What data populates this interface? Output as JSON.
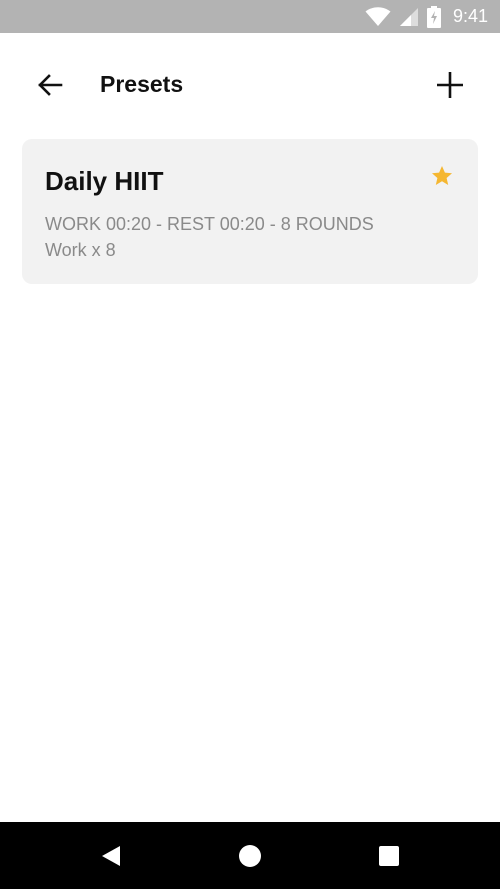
{
  "status_bar": {
    "time": "9:41",
    "icons": [
      "wifi-icon",
      "cell-signal-icon",
      "battery-charging-icon"
    ]
  },
  "app_bar": {
    "title": "Presets",
    "back_icon": "arrow-left-icon",
    "add_icon": "plus-icon"
  },
  "presets": [
    {
      "name": "Daily HIIT",
      "summary": "WORK 00:20 - REST 00:20 - 8 ROUNDS",
      "detail": "Work x 8",
      "favorite": true,
      "star_color": "#F5B731"
    }
  ],
  "nav_bar": {
    "icons": [
      "nav-back-icon",
      "nav-home-icon",
      "nav-recents-icon"
    ]
  },
  "colors": {
    "status_bar": "#B3B3B3",
    "card_background": "#F2F2F2",
    "secondary_text": "#8A8A8A",
    "accent_star": "#F5B731"
  }
}
